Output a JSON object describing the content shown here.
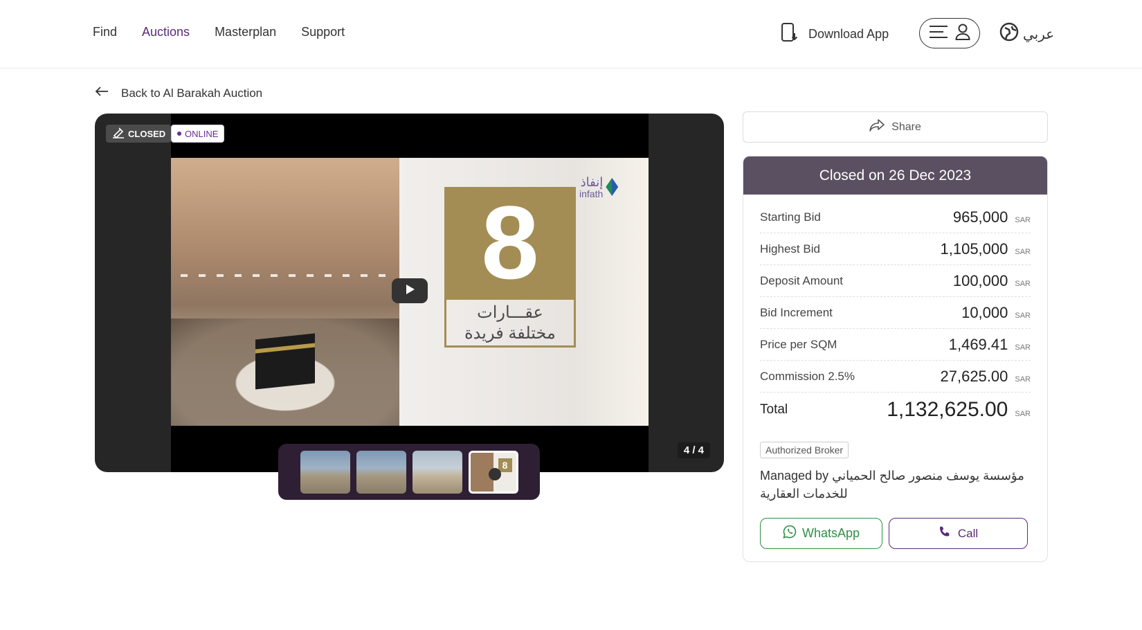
{
  "nav": {
    "items": [
      {
        "label": "Find",
        "active": false
      },
      {
        "label": "Auctions",
        "active": true
      },
      {
        "label": "Masterplan",
        "active": false
      },
      {
        "label": "Support",
        "active": false
      }
    ],
    "download_label": "Download App",
    "language_label": "عربي"
  },
  "back_label": "Back to Al Barakah Auction",
  "viewer": {
    "badge_closed": "CLOSED",
    "badge_online": "ONLINE",
    "counter": "4 / 4",
    "slide_number": "8",
    "slide_text_line1": "عقـــارات",
    "slide_text_line2": "مختلفة فريدة",
    "logo_ar": "إنفاذ",
    "logo_en": "infath",
    "thumbnails": 4,
    "active_thumbnail": 4
  },
  "share_label": "Share",
  "card": {
    "header": "Closed on 26 Dec 2023",
    "currency": "SAR",
    "rows": [
      {
        "label": "Starting Bid",
        "value": "965,000"
      },
      {
        "label": "Highest Bid",
        "value": "1,105,000"
      },
      {
        "label": "Deposit Amount",
        "value": "100,000"
      },
      {
        "label": "Bid Increment",
        "value": "10,000"
      },
      {
        "label": "Price per SQM",
        "value": "1,469.41"
      },
      {
        "label": "Commission 2.5%",
        "value": "27,625.00"
      }
    ],
    "total_label": "Total",
    "total_value": "1,132,625.00",
    "broker_badge": "Authorized Broker",
    "managed_prefix": "Managed by",
    "managed_name": "مؤسسة يوسف منصور صالح الحمياني للخدمات العقارية",
    "whatsapp_label": "WhatsApp",
    "call_label": "Call"
  },
  "colors": {
    "brand_purple": "#5a2a78",
    "card_header": "#5b5061",
    "whatsapp_green": "#2f8f45"
  }
}
